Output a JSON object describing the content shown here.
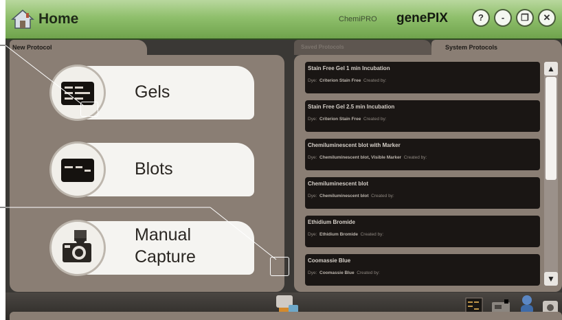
{
  "header": {
    "title": "Home",
    "product": "ChemiPRO",
    "brand": "genePIX",
    "buttons": [
      {
        "label": "?",
        "name": "help"
      },
      {
        "label": "-",
        "name": "minimize"
      },
      {
        "label": "❐",
        "name": "restore"
      },
      {
        "label": "✕",
        "name": "close"
      }
    ]
  },
  "left_panel": {
    "tab_label": "New Protocol",
    "protocols": [
      {
        "label": "Gels",
        "icon": "gel-icon"
      },
      {
        "label": "Blots",
        "icon": "blot-icon"
      },
      {
        "label": "Manual",
        "label2": "Capture",
        "icon": "camera-icon"
      }
    ]
  },
  "right_panel": {
    "tabs": [
      "Saved Protocols",
      "System Protocols"
    ],
    "items": [
      {
        "title": "Stain Free Gel 1 min Incubation",
        "dye_label": "Dye:",
        "dye": "Criterion Stain Free",
        "created": "Created by:"
      },
      {
        "title": "Stain Free Gel 2.5 min Incubation",
        "dye_label": "Dye:",
        "dye": "Criterion Stain Free",
        "created": "Created by:"
      },
      {
        "title": "Chemiluminescent blot with Marker",
        "dye_label": "Dye:",
        "dye": "Chemiluminescent blot, Visible Marker",
        "created": "Created by:"
      },
      {
        "title": "Chemiluminescent blot",
        "dye_label": "Dye:",
        "dye": "Chemiluminescent blot",
        "created": "Created by:"
      },
      {
        "title": "Ethidium Bromide",
        "dye_label": "Dye:",
        "dye": "Ethidium Bromide",
        "created": "Created by:"
      },
      {
        "title": "Coomassie Blue",
        "dye_label": "Dye:",
        "dye": "Coomassie Blue",
        "created": "Created by:"
      }
    ]
  },
  "colors": {
    "titlebar": "#8fbf6c",
    "panel": "#8a7e74",
    "background": "#3a3835",
    "list_item": "#1a1614"
  }
}
